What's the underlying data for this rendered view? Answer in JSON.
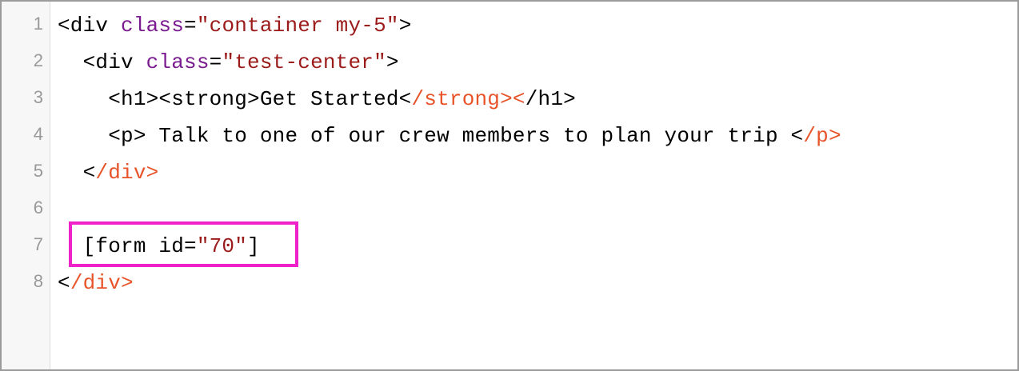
{
  "editor": {
    "lines": [
      {
        "number": "1",
        "tokens": [
          {
            "t": "<div ",
            "c": "tag"
          },
          {
            "t": "class",
            "c": "attr"
          },
          {
            "t": "=",
            "c": "plain"
          },
          {
            "t": "\"container my-5\"",
            "c": "str"
          },
          {
            "t": ">",
            "c": "tag"
          }
        ]
      },
      {
        "number": "2",
        "tokens": [
          {
            "t": "  <div ",
            "c": "tag"
          },
          {
            "t": "class",
            "c": "attr"
          },
          {
            "t": "=",
            "c": "plain"
          },
          {
            "t": "\"test-center\"",
            "c": "str"
          },
          {
            "t": ">",
            "c": "tag"
          }
        ]
      },
      {
        "number": "3",
        "tokens": [
          {
            "t": "    <h1><strong>Get Started<",
            "c": "tag"
          },
          {
            "t": "/strong>",
            "c": "close"
          },
          {
            "t": "<",
            "c": "close"
          },
          {
            "t": "/h1>",
            "c": "tag"
          }
        ]
      },
      {
        "number": "4",
        "tokens": [
          {
            "t": "    <p> Talk to one of our crew members to plan your trip <",
            "c": "tag"
          },
          {
            "t": "/p>",
            "c": "close"
          }
        ]
      },
      {
        "number": "5",
        "tokens": [
          {
            "t": "  <",
            "c": "tag"
          },
          {
            "t": "/div>",
            "c": "close"
          }
        ]
      },
      {
        "number": "6",
        "tokens": []
      },
      {
        "number": "7",
        "tokens": [
          {
            "t": "  [form id=",
            "c": "plain"
          },
          {
            "t": "\"70\"",
            "c": "str"
          },
          {
            "t": "]",
            "c": "plain"
          }
        ]
      },
      {
        "number": "8",
        "tokens": [
          {
            "t": "<",
            "c": "tag"
          },
          {
            "t": "/div>",
            "c": "close"
          }
        ]
      }
    ],
    "highlight_color": "#ee22c8",
    "colors": {
      "tag": "#000000",
      "attr": "#7a1c8f",
      "str": "#9b1b1b",
      "close": "#e8542a",
      "line_number": "#999999",
      "gutter_bg": "#f7f7f7",
      "border": "#9b9b9b"
    }
  }
}
